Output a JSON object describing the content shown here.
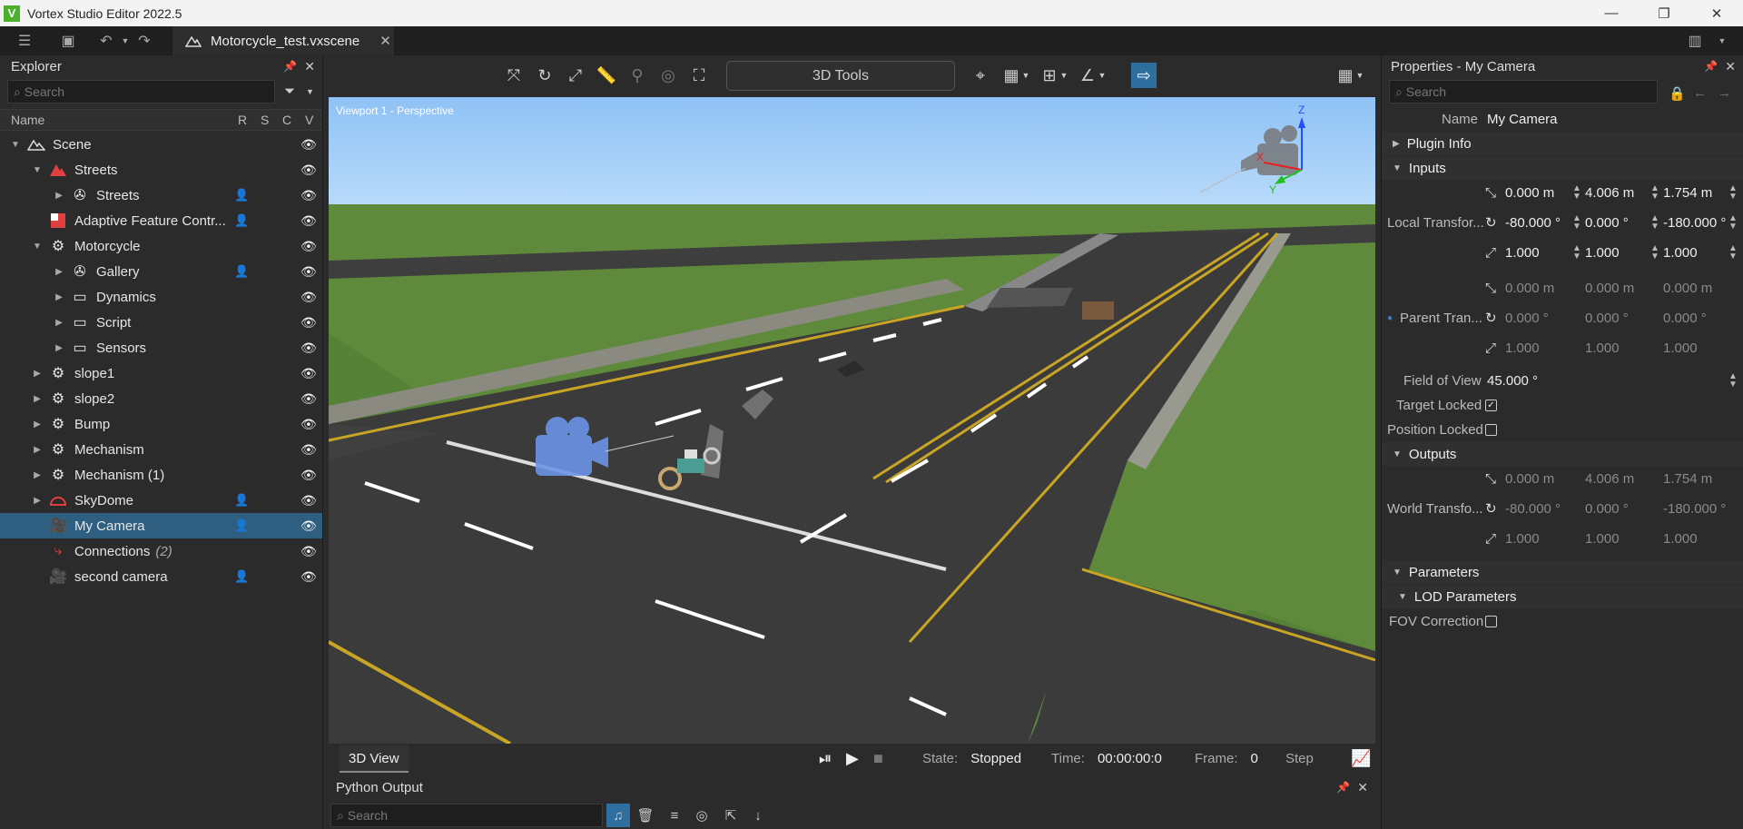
{
  "window": {
    "title": "Vortex Studio Editor 2022.5",
    "app_badge": "V",
    "minimize": "—",
    "restore": "❐",
    "close": "✕"
  },
  "toolbar": {
    "menu_icon": "hamburger-icon",
    "document_tab": "Motorcycle_test.vxscene"
  },
  "explorer": {
    "title": "Explorer",
    "search_placeholder": "Search",
    "columns": {
      "name": "Name",
      "r": "R",
      "s": "S",
      "c": "C",
      "v": "V"
    },
    "items": [
      {
        "label": "Scene",
        "icon": "scene-icon"
      },
      {
        "label": "Streets",
        "icon": "terrain-icon"
      },
      {
        "label": "Streets",
        "icon": "gallery-icon"
      },
      {
        "label": "Adaptive Feature Contr...",
        "icon": "afc-icon"
      },
      {
        "label": "Motorcycle",
        "icon": "gear-icon"
      },
      {
        "label": "Gallery",
        "icon": "gallery-icon"
      },
      {
        "label": "Dynamics",
        "icon": "folder-icon"
      },
      {
        "label": "Script",
        "icon": "folder-icon"
      },
      {
        "label": "Sensors",
        "icon": "folder-icon"
      },
      {
        "label": "slope1",
        "icon": "gear-icon"
      },
      {
        "label": "slope2",
        "icon": "gear-icon"
      },
      {
        "label": "Bump",
        "icon": "gear-icon"
      },
      {
        "label": "Mechanism",
        "icon": "gear-icon"
      },
      {
        "label": "Mechanism (1)",
        "icon": "gear-icon"
      },
      {
        "label": "SkyDome",
        "icon": "skydome-icon"
      },
      {
        "label": "My Camera",
        "icon": "camera-icon"
      },
      {
        "label": "Connections",
        "count": "(2)",
        "icon": "connections-icon"
      },
      {
        "label": "second camera",
        "icon": "camera-icon"
      }
    ]
  },
  "viewport": {
    "tools_button": "3D Tools",
    "label": "Viewport 1 - Perspective",
    "tab": "3D View",
    "state_label": "State:",
    "state_value": "Stopped",
    "time_label": "Time:",
    "time_value": "00:00:00:0",
    "frame_label": "Frame:",
    "frame_value": "0",
    "step_label": "Step",
    "axis": {
      "z": "Z",
      "y": "Y",
      "x": "X"
    }
  },
  "python": {
    "title": "Python Output",
    "search_placeholder": "Search"
  },
  "properties": {
    "title": "Properties - My Camera",
    "search_placeholder": "Search",
    "name_label": "Name",
    "name_value": "My Camera",
    "plugin_info": "Plugin Info",
    "inputs": "Inputs",
    "local_transform": "Local Transfor...",
    "local": {
      "tx": "0.000 m",
      "ty": "4.006 m",
      "tz": "1.754 m",
      "rx": "-80.000 °",
      "ry": "0.000 °",
      "rz": "-180.000 °",
      "sx": "1.000",
      "sy": "1.000",
      "sz": "1.000"
    },
    "parent_transform": "Parent Tran...",
    "parent": {
      "tx": "0.000 m",
      "ty": "0.000 m",
      "tz": "0.000 m",
      "rx": "0.000 °",
      "ry": "0.000 °",
      "rz": "0.000 °",
      "sx": "1.000",
      "sy": "1.000",
      "sz": "1.000"
    },
    "fov_label": "Field of View",
    "fov_value": "45.000 °",
    "target_locked": "Target Locked",
    "position_locked": "Position Locked",
    "outputs": "Outputs",
    "world_transform": "World Transfo...",
    "world": {
      "tx": "0.000 m",
      "ty": "4.006 m",
      "tz": "1.754 m",
      "rx": "-80.000 °",
      "ry": "0.000 °",
      "rz": "-180.000 °",
      "sx": "1.000",
      "sy": "1.000",
      "sz": "1.000"
    },
    "parameters": "Parameters",
    "lod_parameters": "LOD Parameters",
    "fov_correction": "FOV Correction"
  }
}
